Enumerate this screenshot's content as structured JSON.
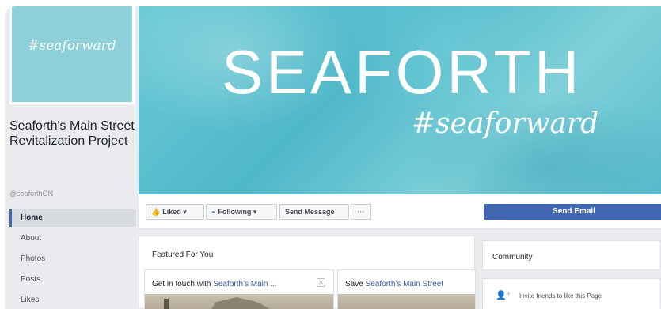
{
  "profile": {
    "picture_text": "#seaforward",
    "page_name": "Seaforth's Main Street Revitalization Project",
    "handle": "@seaforthON"
  },
  "nav": {
    "items": [
      {
        "label": "Home"
      },
      {
        "label": "About"
      },
      {
        "label": "Photos"
      },
      {
        "label": "Posts"
      },
      {
        "label": "Likes"
      }
    ]
  },
  "cover": {
    "title": "SEAFORTH",
    "subtitle": "#seaforward"
  },
  "actions": {
    "liked_label": "Liked ▾",
    "following_label": "Following ▾",
    "message_label": "Send Message",
    "more_label": "···",
    "email_label": "Send Email"
  },
  "featured": {
    "title": "Featured For You",
    "cards": [
      {
        "prefix": "Get in touch with ",
        "link": "Seaforth's Main ..."
      },
      {
        "prefix": "Save ",
        "link": "Seaforth's Main Street"
      }
    ]
  },
  "community": {
    "title": "Community",
    "invite_text": "Invite friends to like this Page"
  },
  "colors": {
    "accent": "#4267b2",
    "cover": "#5cbccd",
    "link": "#365899"
  }
}
